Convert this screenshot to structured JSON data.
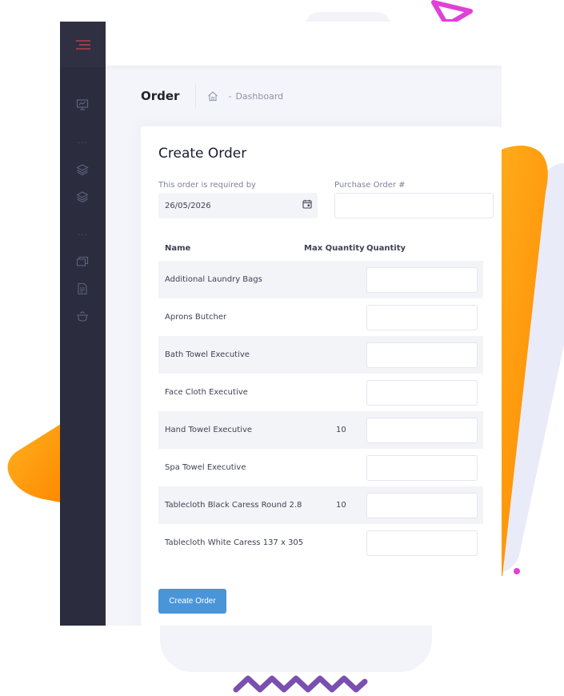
{
  "header": {
    "page_title": "Order",
    "breadcrumb_separator": "-",
    "breadcrumb_link": "Dashboard"
  },
  "sidebar": {
    "dots": "...",
    "items": [
      {
        "icon": "presentation-chart-icon"
      },
      {
        "icon": "layers-icon"
      },
      {
        "icon": "layers-icon"
      },
      {
        "icon": "folders-icon"
      },
      {
        "icon": "document-icon"
      },
      {
        "icon": "cooking-pot-icon"
      }
    ]
  },
  "form": {
    "title": "Create Order",
    "required_by_label": "This order is required by",
    "required_by_value": "26/05/2026",
    "po_label": "Purchase Order #",
    "po_value": "",
    "submit_label": "Create Order"
  },
  "table": {
    "columns": [
      "Name",
      "Max Quantity",
      "Quantity"
    ],
    "rows": [
      {
        "name": "Additional Laundry Bags",
        "max": "",
        "qty": ""
      },
      {
        "name": "Aprons Butcher",
        "max": "",
        "qty": ""
      },
      {
        "name": "Bath Towel Executive",
        "max": "",
        "qty": ""
      },
      {
        "name": "Face Cloth Executive",
        "max": "",
        "qty": ""
      },
      {
        "name": "Hand Towel Executive",
        "max": "10",
        "qty": ""
      },
      {
        "name": "Spa Towel Executive",
        "max": "",
        "qty": ""
      },
      {
        "name": "Tablecloth Black Caress Round 2.8",
        "max": "10",
        "qty": ""
      },
      {
        "name": "Tablecloth White Caress 137 x 305",
        "max": "",
        "qty": ""
      }
    ]
  },
  "colors": {
    "accent_orange": "#ff9a1f",
    "accent_magenta": "#e040d8",
    "accent_purple": "#7b4fb0",
    "button_blue": "#4a95d8",
    "sidebar_bg": "#2b2d3e"
  }
}
